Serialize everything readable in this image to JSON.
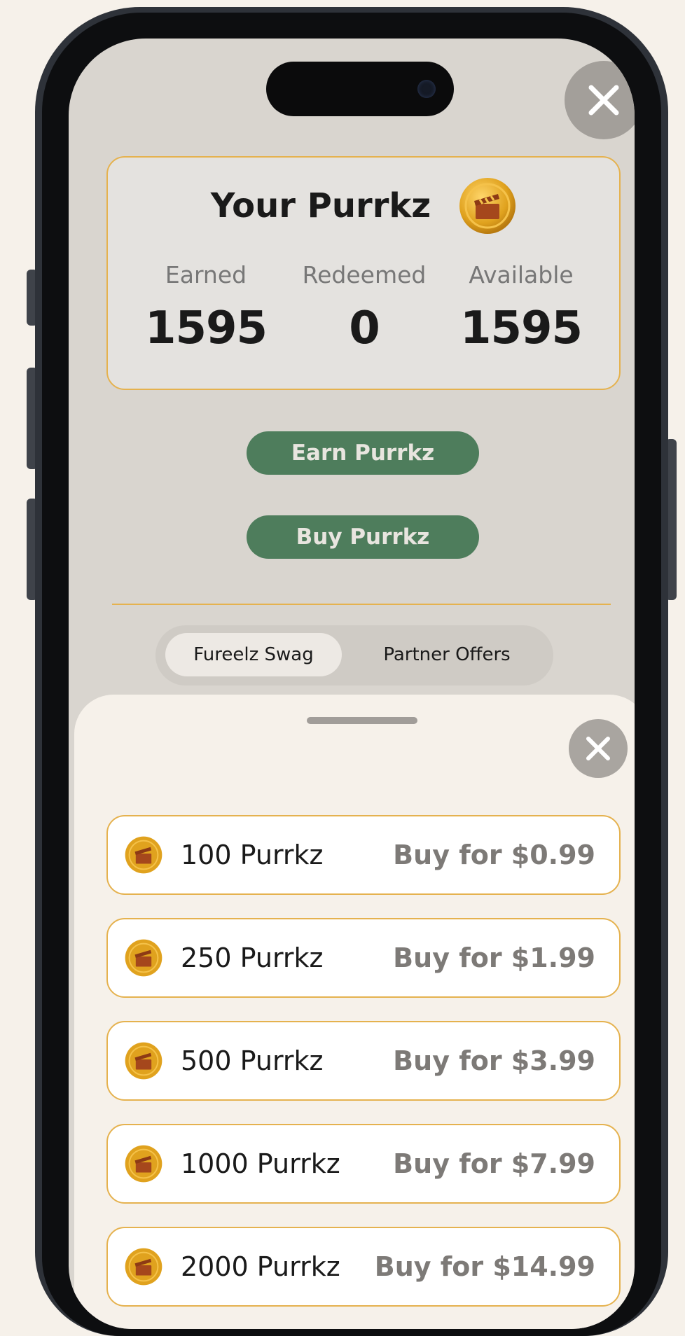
{
  "summary": {
    "title": "Your Purrkz",
    "stats": [
      {
        "label": "Earned",
        "value": "1595"
      },
      {
        "label": "Redeemed",
        "value": "0"
      },
      {
        "label": "Available",
        "value": "1595"
      }
    ]
  },
  "actions": {
    "earn_label": "Earn Purrkz",
    "buy_label": "Buy Purrkz"
  },
  "tabs": [
    {
      "label": "Fureelz Swag",
      "active": true
    },
    {
      "label": "Partner Offers",
      "active": false
    }
  ],
  "buy_sheet": {
    "options": [
      {
        "quantity": "100 Purrkz",
        "price": "Buy for $0.99"
      },
      {
        "quantity": "250 Purrkz",
        "price": "Buy for $1.99"
      },
      {
        "quantity": "500 Purrkz",
        "price": "Buy for $3.99"
      },
      {
        "quantity": "1000 Purrkz",
        "price": "Buy for $7.99"
      },
      {
        "quantity": "2000 Purrkz",
        "price": "Buy for $14.99"
      }
    ]
  },
  "colors": {
    "accent_green": "#4e7d5c",
    "border_gold": "#e5b24f",
    "coin_gold": "#e0a21e",
    "screen_bg": "#d9d5cf",
    "sheet_bg": "#f6f1ea"
  },
  "icons": {
    "close": "close-icon",
    "coin": "clapperboard-coin-icon"
  }
}
